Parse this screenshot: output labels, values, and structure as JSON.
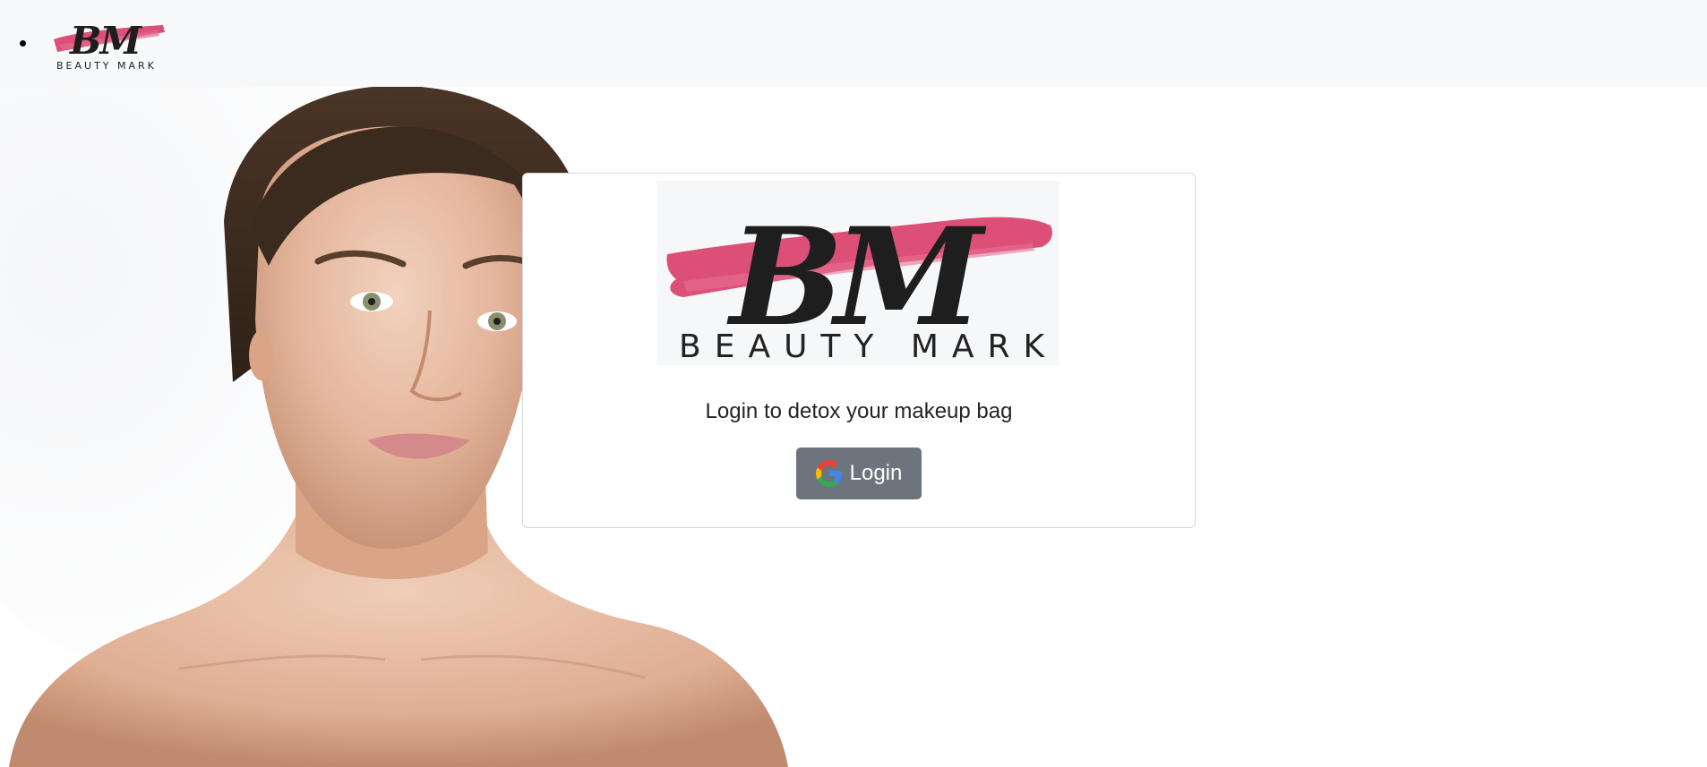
{
  "navbar": {
    "brand": {
      "monogram": "BM",
      "wordmark": "BEAUTY MARK"
    }
  },
  "hero": {
    "image": "portrait-woman-bare-shoulders"
  },
  "card": {
    "logo": {
      "monogram": "BM",
      "wordmark": "BEAUTY MARK"
    },
    "tagline": "Login to detox your makeup bag",
    "login_button": {
      "label": "Login",
      "icon": "google-icon"
    }
  },
  "colors": {
    "navbar_bg": "#f8f9fa",
    "brand_pink": "#dc5078",
    "brand_black": "#1e1e1e",
    "button_bg": "#6c757d",
    "text": "#212529"
  }
}
